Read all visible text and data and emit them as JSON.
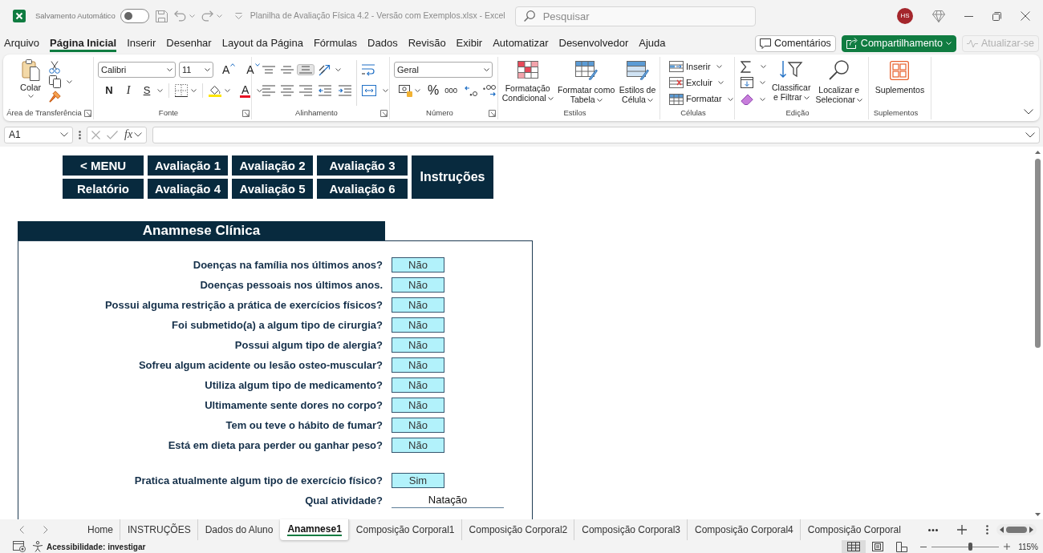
{
  "title_bar": {
    "autosave_label": "Salvamento Automático",
    "autosave_on": false,
    "document_title": "Planilha de Avaliação Física 4.2 - Versão com Exemplos.xlsx - Excel",
    "search": {
      "placeholder": "Pesquisar"
    },
    "avatar": "HS"
  },
  "menu_tabs": [
    {
      "label": "Arquivo",
      "selected": false
    },
    {
      "label": "Página Inicial",
      "selected": true
    },
    {
      "label": "Inserir",
      "selected": false
    },
    {
      "label": "Desenhar",
      "selected": false
    },
    {
      "label": "Layout da Página",
      "selected": false
    },
    {
      "label": "Fórmulas",
      "selected": false
    },
    {
      "label": "Dados",
      "selected": false
    },
    {
      "label": "Revisão",
      "selected": false
    },
    {
      "label": "Exibir",
      "selected": false
    },
    {
      "label": "Automatizar",
      "selected": false
    },
    {
      "label": "Desenvolvedor",
      "selected": false
    },
    {
      "label": "Ajuda",
      "selected": false
    }
  ],
  "header_buttons": [
    {
      "label": "Comentários",
      "kind": "comments",
      "disabled": false
    },
    {
      "label": "Compartilhamento",
      "kind": "share",
      "disabled": false
    },
    {
      "label": "Atualizar-se",
      "kind": "updates",
      "disabled": true
    }
  ],
  "ribbon": {
    "clipboard": {
      "label": "Área de Transferência",
      "paste": "Colar"
    },
    "font": {
      "label": "Fonte",
      "font_name": "Calibri",
      "font_size": "11",
      "grow": "A",
      "shrink": "A",
      "bold": "N",
      "italic": "I",
      "underline": "S",
      "font_color": "A"
    },
    "alignment": {
      "label": "Alinhamento",
      "vertical": [
        {
          "kind": "top",
          "selected": false
        },
        {
          "kind": "middle",
          "selected": false
        },
        {
          "kind": "bottom",
          "selected": true
        }
      ],
      "horizontal": [
        {
          "kind": "left",
          "selected": false
        },
        {
          "kind": "center",
          "selected": false
        },
        {
          "kind": "right",
          "selected": false
        }
      ]
    },
    "number": {
      "label": "Número",
      "format": "Geral",
      "percent": "%",
      "thousands": "000"
    },
    "styles": {
      "label": "Estilos",
      "buttons": [
        {
          "label": "Formatação\nCondicional",
          "kind": "conditional"
        },
        {
          "label": "Formatar como\nTabela",
          "kind": "table"
        },
        {
          "label": "Estilos de\nCélula",
          "kind": "cell"
        }
      ]
    },
    "cells": {
      "label": "Células",
      "buttons": [
        {
          "label": "Inserir",
          "kind": "insert"
        },
        {
          "label": "Excluir",
          "kind": "delete"
        },
        {
          "label": "Formatar",
          "kind": "format"
        }
      ]
    },
    "editing": {
      "label": "Edição",
      "buttons": [
        {
          "label": "Classificar\ne Filtrar",
          "kind": "sort"
        },
        {
          "label": "Localizar e\nSelecionar",
          "kind": "find"
        }
      ]
    },
    "addins": {
      "label": "Suplementos",
      "button": "Suplementos"
    }
  },
  "formula_bar": {
    "name_box": "A1",
    "function_button": "fx"
  },
  "sheet": {
    "nav_buttons": [
      {
        "label": "< MENU",
        "kind": "regular"
      },
      {
        "label": "Avaliação 1",
        "kind": "regular"
      },
      {
        "label": "Avaliação 2",
        "kind": "regular"
      },
      {
        "label": "Avaliação 3",
        "kind": "regular"
      },
      {
        "label": "Instruções",
        "kind": "tall"
      },
      {
        "label": "Relatório",
        "kind": "regular"
      },
      {
        "label": "Avaliação 4",
        "kind": "regular"
      },
      {
        "label": "Avaliação 5",
        "kind": "regular"
      },
      {
        "label": "Avaliação 6",
        "kind": "regular"
      }
    ],
    "section": {
      "title": "Anamnese Clínica",
      "question_groups": [
        {
          "questions": [
            {
              "label": "Doenças na família nos últimos anos?",
              "answer": "Não",
              "kind": "choice"
            },
            {
              "label": "Doenças pessoais nos últimos anos.",
              "answer": "Não",
              "kind": "choice"
            },
            {
              "label": "Possui alguma restrição a prática de exercícios físicos?",
              "answer": "Não",
              "kind": "choice"
            },
            {
              "label": "Foi submetido(a) a algum tipo de cirurgia?",
              "answer": "Não",
              "kind": "choice"
            },
            {
              "label": "Possui algum tipo de alergia?",
              "answer": "Não",
              "kind": "choice"
            },
            {
              "label": "Sofreu algum acidente ou lesão osteo-muscular?",
              "answer": "Não",
              "kind": "choice"
            },
            {
              "label": "Utiliza algum tipo de medicamento?",
              "answer": "Não",
              "kind": "choice"
            },
            {
              "label": "Ultimamente sente dores no corpo?",
              "answer": "Não",
              "kind": "choice"
            },
            {
              "label": "Tem ou teve o hábito de fumar?",
              "answer": "Não",
              "kind": "choice"
            },
            {
              "label": "Está em dieta para perder ou ganhar peso?",
              "answer": "Não",
              "kind": "choice"
            }
          ]
        },
        {
          "questions": [
            {
              "label": "Pratica atualmente algum tipo de exercício físico?",
              "answer": "Sim",
              "kind": "choice"
            },
            {
              "label": "Qual atividade?",
              "answer": "Natação",
              "kind": "text"
            }
          ]
        }
      ]
    }
  },
  "sheet_tabs": [
    {
      "label": "Home",
      "selected": false
    },
    {
      "label": "INSTRUÇÕES",
      "selected": false
    },
    {
      "label": "Dados do Aluno",
      "selected": false
    },
    {
      "label": "Anamnese1",
      "selected": true
    },
    {
      "label": "Composição Corporal1",
      "selected": false
    },
    {
      "label": "Composição Corporal2",
      "selected": false
    },
    {
      "label": "Composição Corporal3",
      "selected": false
    },
    {
      "label": "Composição Corporal4",
      "selected": false
    },
    {
      "label": "Composição Corporal",
      "selected": false
    }
  ],
  "status_bar": {
    "accessibility": "Acessibilidade: investigar",
    "views": [
      {
        "kind": "normal",
        "selected": true
      },
      {
        "kind": "page_layout",
        "selected": false
      },
      {
        "kind": "page_break",
        "selected": false
      }
    ],
    "zoom": {
      "level": 0.58,
      "reading": "115%"
    }
  }
}
